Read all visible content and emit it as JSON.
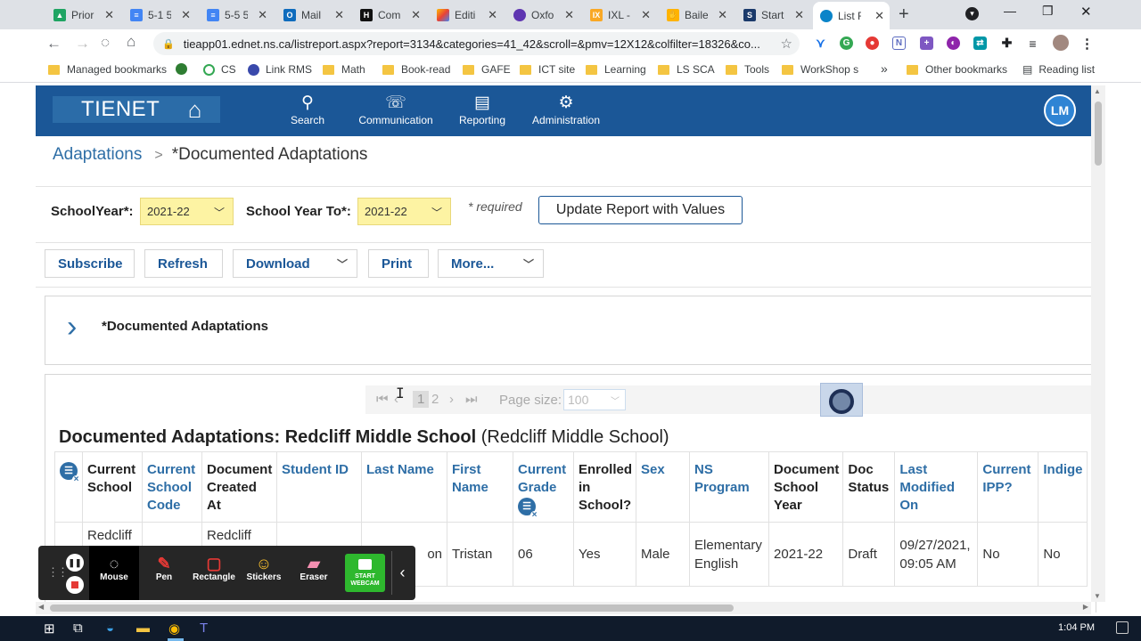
{
  "browser": {
    "tabs": [
      {
        "label": "Priori",
        "icon": "google-drive-icon",
        "color": "#1fa463"
      },
      {
        "label": "5-1 5",
        "icon": "google-docs-icon",
        "color": "#4285f4"
      },
      {
        "label": "5-5 5",
        "icon": "google-docs-icon",
        "color": "#4285f4"
      },
      {
        "label": "Mail",
        "icon": "outlook-icon",
        "color": "#0f6cbd"
      },
      {
        "label": "Comp",
        "icon": "h-icon",
        "color": "#111111"
      },
      {
        "label": "Editi",
        "icon": "slides-icon",
        "color": "#ff7043"
      },
      {
        "label": "Oxfo",
        "icon": "oxford-icon",
        "color": "#5e35b1"
      },
      {
        "label": "IXL -",
        "icon": "ixl-icon",
        "color": "#f9a825"
      },
      {
        "label": "Baile",
        "icon": "hand-icon",
        "color": "#ffb300"
      },
      {
        "label": "Start",
        "icon": "sis-icon",
        "color": "#1b3a6b"
      },
      {
        "label": "List R",
        "icon": "tienet-icon",
        "color": "#0a84c9"
      }
    ],
    "url": "tieapp01.ednet.ns.ca/listreport.aspx?report=3134&categories=41_42&scroll=&pmv=12X12&colfilter=18326&co...",
    "bookmarks": [
      "Managed bookmarks",
      "",
      "CS",
      "Link RMS",
      "Math",
      "Book-read",
      "GAFE",
      "ICT site",
      "Learning",
      "LS SCA",
      "Tools",
      "WorkShop s"
    ],
    "bookmarks_more": "»",
    "other_bookmarks": "Other bookmarks",
    "reading_list": "Reading list"
  },
  "app": {
    "logo": "TIENET",
    "nav": [
      {
        "label": "Search",
        "icon": "search-icon"
      },
      {
        "label": "Communication",
        "icon": "communication-icon"
      },
      {
        "label": "Reporting",
        "icon": "reporting-icon"
      },
      {
        "label": "Administration",
        "icon": "gear-icon"
      }
    ],
    "avatar": "LM",
    "breadcrumb": {
      "parent": "Adaptations",
      "separator": ">",
      "current": "*Documented Adaptations"
    }
  },
  "filters": {
    "school_year_label": "SchoolYear*:",
    "school_year_value": "2021-22",
    "school_year_to_label": "School Year To*:",
    "school_year_to_value": "2021-22",
    "required_note": "* required",
    "update_button": "Update Report with Values"
  },
  "actions": {
    "subscribe": "Subscribe",
    "refresh": "Refresh",
    "download": "Download",
    "print": "Print",
    "more": "More..."
  },
  "collapsible": {
    "title": "*Documented Adaptations"
  },
  "pager": {
    "current_page": "1",
    "next_page": "2",
    "page_size_label": "Page size:",
    "page_size_value": "100"
  },
  "report": {
    "title_bold": "Documented Adaptations: Redcliff Middle School",
    "title_suffix": "(Redcliff Middle School)",
    "columns": [
      "Current School",
      "Current School Code",
      "Document Created At",
      "Student ID",
      "Last Name",
      "First Name",
      "Current Grade",
      "Enrolled in School?",
      "Sex",
      "NS Program",
      "Document School Year",
      "Doc Status",
      "Last Modified On",
      "Current IPP?",
      "Indige"
    ],
    "row": {
      "current_school": "Redcliff",
      "doc_created_at": "Redcliff",
      "last_name": "on",
      "first_name": "Tristan",
      "grade": "06",
      "enrolled": "Yes",
      "sex": "Male",
      "program": "Elementary English",
      "school_year": "2021-22",
      "status": "Draft",
      "modified": "09/27/2021, 09:05 AM",
      "ipp": "No",
      "indige": "No"
    }
  },
  "drawing_toolbar": {
    "tools": [
      "Mouse",
      "Pen",
      "Rectangle",
      "Stickers",
      "Eraser"
    ],
    "webcam": "START WEBCAM"
  },
  "taskbar": {
    "time": "1:04 PM"
  },
  "colors": {
    "header_blue": "#1b5797",
    "link_blue": "#2e6ea6",
    "select_yellow": "#fdf3a3"
  }
}
